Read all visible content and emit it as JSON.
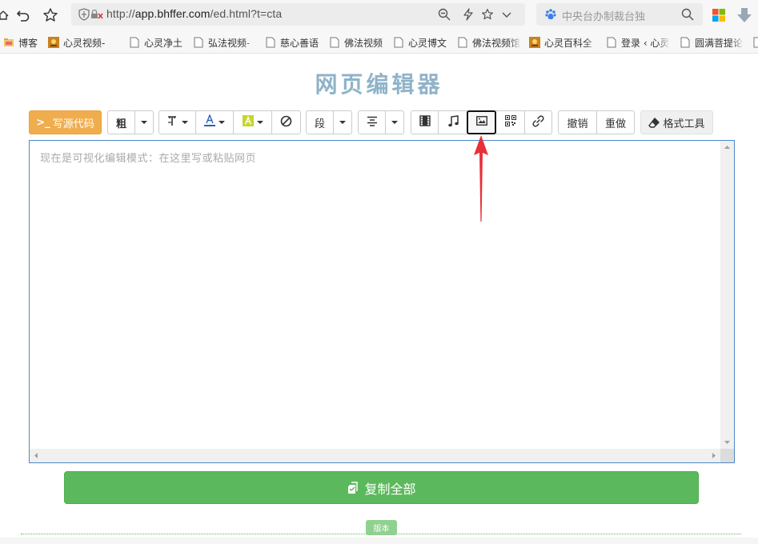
{
  "browser": {
    "url_prefix": "http://",
    "url_domain": "app.bhffer.com",
    "url_path": "/ed.html?t=cta",
    "search_placeholder": "中央台办制裁台独"
  },
  "bookmarks": [
    {
      "label": "博客",
      "icon": "folder-icon"
    },
    {
      "label": "心灵视频-",
      "icon": "site-logo-icon"
    },
    {
      "label": "心灵净土",
      "icon": "page-icon"
    },
    {
      "label": "弘法视频-",
      "icon": "page-icon"
    },
    {
      "label": "慈心善语",
      "icon": "page-icon"
    },
    {
      "label": "佛法视频",
      "icon": "page-icon"
    },
    {
      "label": "心灵博文",
      "icon": "page-icon"
    },
    {
      "label": "佛法视频馆",
      "icon": "page-icon"
    },
    {
      "label": "心灵百科全",
      "icon": "site-logo-icon"
    },
    {
      "label": "登录 ‹ 心灵",
      "icon": "page-icon"
    },
    {
      "label": "圆满菩提论",
      "icon": "page-icon"
    }
  ],
  "page": {
    "title": "网页编辑器",
    "editor_placeholder": "现在是可视化编辑模式：在这里写或粘贴网页",
    "copy_all_label": "复制全部",
    "version_label": "版本"
  },
  "toolbar": {
    "source_code": "写源代码",
    "bold": "粗",
    "paragraph": "段",
    "undo": "撤销",
    "redo": "重做",
    "format_tools": "格式工具"
  },
  "colors": {
    "source_btn": "#f0ad4e",
    "copy_btn": "#5cb85c",
    "title": "#8fb3c8",
    "editor_border": "#4c88c7",
    "annotation_arrow": "#e8303a"
  }
}
